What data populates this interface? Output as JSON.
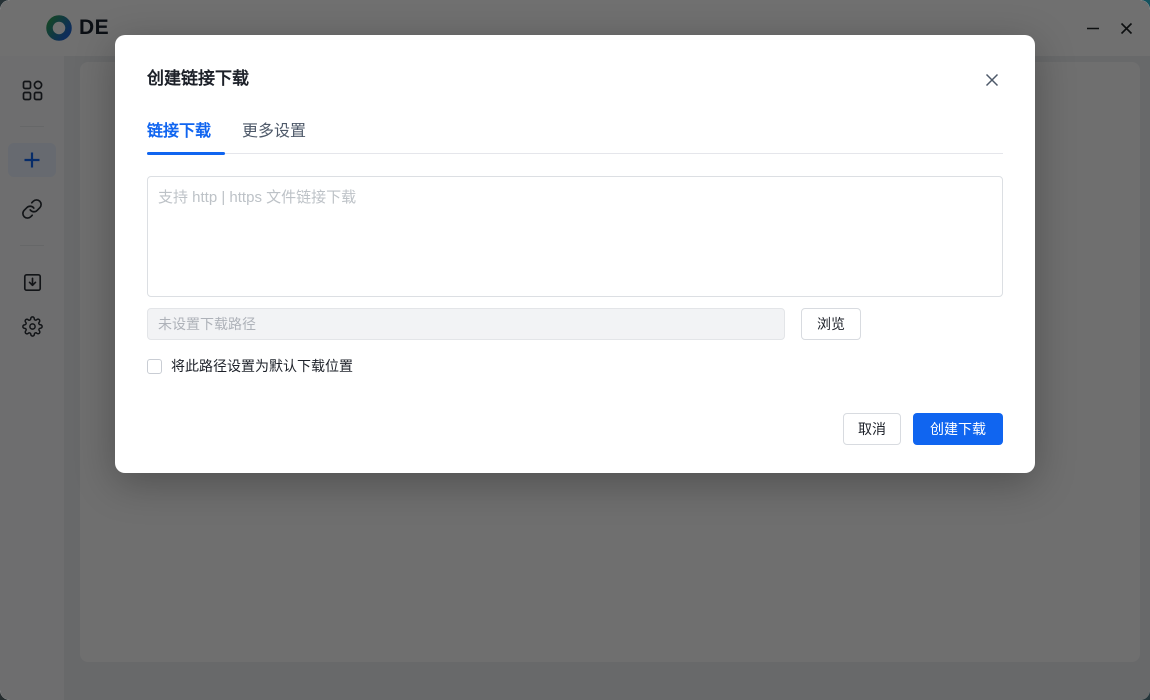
{
  "app": {
    "brand": "DE",
    "window_controls": {
      "minimize": "minimize-icon",
      "close": "close-icon"
    }
  },
  "sidebar": {
    "icons": [
      "apps-grid-icon",
      "plus-icon",
      "link-icon",
      "download-box-icon",
      "gear-icon"
    ],
    "active_icon": "plus-icon"
  },
  "modal": {
    "title": "创建链接下载",
    "close": "close-icon",
    "tabs": [
      {
        "label": "链接下载",
        "active": true
      },
      {
        "label": "更多设置",
        "active": false
      }
    ],
    "url_input": {
      "value": "",
      "placeholder": "支持 http | https 文件链接下载"
    },
    "path_input": {
      "value": "",
      "placeholder": "未设置下载路径"
    },
    "browse_button": "浏览",
    "default_path_checkbox": {
      "label": "将此路径设置为默认下载位置",
      "checked": false
    },
    "cancel_button": "取消",
    "submit_button": "创建下载"
  },
  "colors": {
    "accent": "#1065f0",
    "brand_green": "#2f9e57",
    "brand_blue": "#1f66cf",
    "overlay": "rgba(0,0,0,0.56)"
  }
}
